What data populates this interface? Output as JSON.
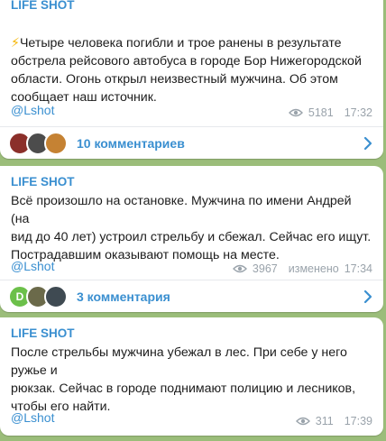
{
  "posts": [
    {
      "channel": "",
      "header_cut": "LIFE SHOT",
      "bolt": "⚡",
      "text": "Четыре человека погибли и трое ранены в результате\nобстрела рейсового автобуса в городе Бор Нижегородской\nобласти. Огонь открыл неизвестный мужчина. Об этом\nсообщает наш источник.",
      "link": "@Lshot",
      "views": "5181",
      "edited": "",
      "time": "17:32",
      "comments_label": "10 комментариев"
    },
    {
      "channel": "LIFE SHOT",
      "text": "Всё произошло на остановке. Мужчина по имени Андрей (на\nвид до 40 лет) устроил стрельбу и сбежал. Сейчас его ищут.\nПострадавшим оказывают помощь на месте.",
      "link": "@Lshot",
      "views": "3967",
      "edited": "изменено",
      "time": "17:34",
      "comments_label": "3 комментария",
      "avatar_letter": "D"
    },
    {
      "channel": "LIFE SHOT",
      "text": "После стрельбы мужчина убежал в лес. При себе у него ружье и\nрюкзак. Сейчас в городе поднимают полицию и лесников,\nчтобы его найти.",
      "link": "@Lshot",
      "views": "311",
      "edited": "",
      "time": "17:39"
    }
  ],
  "colors": {
    "background": "#9bbd7a",
    "accent": "#3a8fd0",
    "meta": "#9aa3ab"
  },
  "icons": {
    "views": "eye-icon",
    "open_comments": "chevron-right-icon"
  }
}
